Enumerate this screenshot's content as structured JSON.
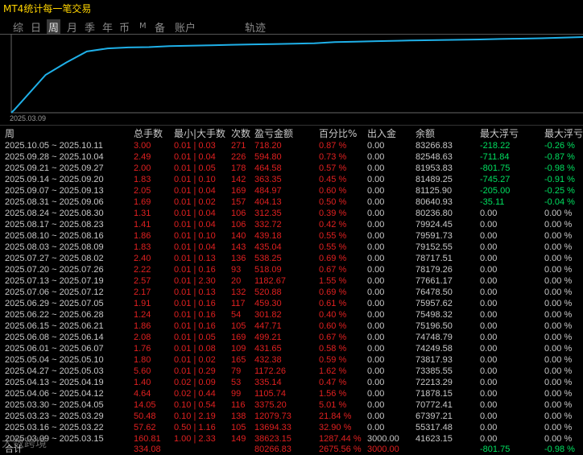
{
  "title": "MT4统计每一笔交易",
  "tabs": [
    {
      "label": "综",
      "active": false
    },
    {
      "label": "日",
      "active": false
    },
    {
      "label": "周",
      "active": true
    },
    {
      "label": "月",
      "active": false
    },
    {
      "label": "季",
      "active": false
    },
    {
      "label": "年",
      "active": false
    },
    {
      "label": "币",
      "active": false
    },
    {
      "label": "M",
      "active": false
    },
    {
      "label": "备",
      "active": false
    },
    {
      "label": "账户",
      "active": false
    },
    {
      "label": "轨迹",
      "active": false
    }
  ],
  "chart_data": {
    "type": "line",
    "x_start_label": "2025.03.09",
    "y": [
      0,
      3000,
      41623.15,
      55317.48,
      67397.21,
      70772.41,
      71878.15,
      72213.29,
      73385.55,
      73817.93,
      74249.58,
      74748.79,
      75196.5,
      75498.32,
      75957.62,
      76478.5,
      77661.17,
      78179.26,
      78717.51,
      79152.55,
      79591.73,
      79924.45,
      80236.8,
      80640.93,
      81125.9,
      81489.25,
      81953.83,
      82548.63,
      83266.83
    ],
    "line_color": "#1fb0e8"
  },
  "headers": {
    "period": "周",
    "lots": "总手数",
    "minmax": "最小|大手数",
    "count": "次数",
    "pnl": "盈亏金额",
    "pct": "百分比%",
    "flow": "出入金",
    "balance": "余额",
    "max_float": "最大浮亏",
    "max_float_pct": "最大浮亏"
  },
  "rows": [
    {
      "period": "2025.10.05 ~ 2025.10.11",
      "lots": "3.00",
      "minmax": "0.01 | 0.03",
      "count": "271",
      "pnl": "718.20",
      "pct": "0.87 %",
      "flow": "0.00",
      "balance": "83266.83",
      "mf": "-218.22",
      "mfp": "-0.26 %"
    },
    {
      "period": "2025.09.28 ~ 2025.10.04",
      "lots": "2.49",
      "minmax": "0.01 | 0.04",
      "count": "226",
      "pnl": "594.80",
      "pct": "0.73 %",
      "flow": "0.00",
      "balance": "82548.63",
      "mf": "-711.84",
      "mfp": "-0.87 %"
    },
    {
      "period": "2025.09.21 ~ 2025.09.27",
      "lots": "2.00",
      "minmax": "0.01 | 0.05",
      "count": "178",
      "pnl": "464.58",
      "pct": "0.57 %",
      "flow": "0.00",
      "balance": "81953.83",
      "mf": "-801.75",
      "mfp": "-0.98 %"
    },
    {
      "period": "2025.09.14 ~ 2025.09.20",
      "lots": "1.83",
      "minmax": "0.01 | 0.10",
      "count": "142",
      "pnl": "363.35",
      "pct": "0.45 %",
      "flow": "0.00",
      "balance": "81489.25",
      "mf": "-745.27",
      "mfp": "-0.91 %"
    },
    {
      "period": "2025.09.07 ~ 2025.09.13",
      "lots": "2.05",
      "minmax": "0.01 | 0.04",
      "count": "169",
      "pnl": "484.97",
      "pct": "0.60 %",
      "flow": "0.00",
      "balance": "81125.90",
      "mf": "-205.00",
      "mfp": "-0.25 %"
    },
    {
      "period": "2025.08.31 ~ 2025.09.06",
      "lots": "1.69",
      "minmax": "0.01 | 0.02",
      "count": "157",
      "pnl": "404.13",
      "pct": "0.50 %",
      "flow": "0.00",
      "balance": "80640.93",
      "mf": "-35.11",
      "mfp": "-0.04 %"
    },
    {
      "period": "2025.08.24 ~ 2025.08.30",
      "lots": "1.31",
      "minmax": "0.01 | 0.04",
      "count": "106",
      "pnl": "312.35",
      "pct": "0.39 %",
      "flow": "0.00",
      "balance": "80236.80",
      "mf": "0.00",
      "mfp": "0.00 %"
    },
    {
      "period": "2025.08.17 ~ 2025.08.23",
      "lots": "1.41",
      "minmax": "0.01 | 0.04",
      "count": "106",
      "pnl": "332.72",
      "pct": "0.42 %",
      "flow": "0.00",
      "balance": "79924.45",
      "mf": "0.00",
      "mfp": "0.00 %"
    },
    {
      "period": "2025.08.10 ~ 2025.08.16",
      "lots": "1.86",
      "minmax": "0.01 | 0.10",
      "count": "140",
      "pnl": "439.18",
      "pct": "0.55 %",
      "flow": "0.00",
      "balance": "79591.73",
      "mf": "0.00",
      "mfp": "0.00 %"
    },
    {
      "period": "2025.08.03 ~ 2025.08.09",
      "lots": "1.83",
      "minmax": "0.01 | 0.04",
      "count": "143",
      "pnl": "435.04",
      "pct": "0.55 %",
      "flow": "0.00",
      "balance": "79152.55",
      "mf": "0.00",
      "mfp": "0.00 %"
    },
    {
      "period": "2025.07.27 ~ 2025.08.02",
      "lots": "2.40",
      "minmax": "0.01 | 0.13",
      "count": "136",
      "pnl": "538.25",
      "pct": "0.69 %",
      "flow": "0.00",
      "balance": "78717.51",
      "mf": "0.00",
      "mfp": "0.00 %"
    },
    {
      "period": "2025.07.20 ~ 2025.07.26",
      "lots": "2.22",
      "minmax": "0.01 | 0.16",
      "count": "93",
      "pnl": "518.09",
      "pct": "0.67 %",
      "flow": "0.00",
      "balance": "78179.26",
      "mf": "0.00",
      "mfp": "0.00 %"
    },
    {
      "period": "2025.07.13 ~ 2025.07.19",
      "lots": "2.57",
      "minmax": "0.01 | 2.30",
      "count": "20",
      "pnl": "1182.67",
      "pct": "1.55 %",
      "flow": "0.00",
      "balance": "77661.17",
      "mf": "0.00",
      "mfp": "0.00 %"
    },
    {
      "period": "2025.07.06 ~ 2025.07.12",
      "lots": "2.17",
      "minmax": "0.01 | 0.13",
      "count": "132",
      "pnl": "520.88",
      "pct": "0.69 %",
      "flow": "0.00",
      "balance": "76478.50",
      "mf": "0.00",
      "mfp": "0.00 %"
    },
    {
      "period": "2025.06.29 ~ 2025.07.05",
      "lots": "1.91",
      "minmax": "0.01 | 0.16",
      "count": "117",
      "pnl": "459.30",
      "pct": "0.61 %",
      "flow": "0.00",
      "balance": "75957.62",
      "mf": "0.00",
      "mfp": "0.00 %"
    },
    {
      "period": "2025.06.22 ~ 2025.06.28",
      "lots": "1.24",
      "minmax": "0.01 | 0.16",
      "count": "54",
      "pnl": "301.82",
      "pct": "0.40 %",
      "flow": "0.00",
      "balance": "75498.32",
      "mf": "0.00",
      "mfp": "0.00 %"
    },
    {
      "period": "2025.06.15 ~ 2025.06.21",
      "lots": "1.86",
      "minmax": "0.01 | 0.16",
      "count": "105",
      "pnl": "447.71",
      "pct": "0.60 %",
      "flow": "0.00",
      "balance": "75196.50",
      "mf": "0.00",
      "mfp": "0.00 %"
    },
    {
      "period": "2025.06.08 ~ 2025.06.14",
      "lots": "2.08",
      "minmax": "0.01 | 0.05",
      "count": "169",
      "pnl": "499.21",
      "pct": "0.67 %",
      "flow": "0.00",
      "balance": "74748.79",
      "mf": "0.00",
      "mfp": "0.00 %"
    },
    {
      "period": "2025.06.01 ~ 2025.06.07",
      "lots": "1.76",
      "minmax": "0.01 | 0.08",
      "count": "109",
      "pnl": "431.65",
      "pct": "0.58 %",
      "flow": "0.00",
      "balance": "74249.58",
      "mf": "0.00",
      "mfp": "0.00 %"
    },
    {
      "period": "2025.05.04 ~ 2025.05.10",
      "lots": "1.80",
      "minmax": "0.01 | 0.02",
      "count": "165",
      "pnl": "432.38",
      "pct": "0.59 %",
      "flow": "0.00",
      "balance": "73817.93",
      "mf": "0.00",
      "mfp": "0.00 %"
    },
    {
      "period": "2025.04.27 ~ 2025.05.03",
      "lots": "5.60",
      "minmax": "0.01 | 0.29",
      "count": "79",
      "pnl": "1172.26",
      "pct": "1.62 %",
      "flow": "0.00",
      "balance": "73385.55",
      "mf": "0.00",
      "mfp": "0.00 %"
    },
    {
      "period": "2025.04.13 ~ 2025.04.19",
      "lots": "1.40",
      "minmax": "0.02 | 0.09",
      "count": "53",
      "pnl": "335.14",
      "pct": "0.47 %",
      "flow": "0.00",
      "balance": "72213.29",
      "mf": "0.00",
      "mfp": "0.00 %"
    },
    {
      "period": "2025.04.06 ~ 2025.04.12",
      "lots": "4.64",
      "minmax": "0.02 | 0.44",
      "count": "99",
      "pnl": "1105.74",
      "pct": "1.56 %",
      "flow": "0.00",
      "balance": "71878.15",
      "mf": "0.00",
      "mfp": "0.00 %"
    },
    {
      "period": "2025.03.30 ~ 2025.04.05",
      "lots": "14.05",
      "minmax": "0.10 | 0.54",
      "count": "116",
      "pnl": "3375.20",
      "pct": "5.01 %",
      "flow": "0.00",
      "balance": "70772.41",
      "mf": "0.00",
      "mfp": "0.00 %"
    },
    {
      "period": "2025.03.23 ~ 2025.03.29",
      "lots": "50.48",
      "minmax": "0.10 | 2.19",
      "count": "138",
      "pnl": "12079.73",
      "pct": "21.84 %",
      "flow": "0.00",
      "balance": "67397.21",
      "mf": "0.00",
      "mfp": "0.00 %"
    },
    {
      "period": "2025.03.16 ~ 2025.03.22",
      "lots": "57.62",
      "minmax": "0.50 | 1.16",
      "count": "105",
      "pnl": "13694.33",
      "pct": "32.90 %",
      "flow": "0.00",
      "balance": "55317.48",
      "mf": "0.00",
      "mfp": "0.00 %"
    },
    {
      "period": "2025.03.09 ~ 2025.03.15",
      "lots": "160.81",
      "minmax": "1.00 | 2.33",
      "count": "149",
      "pnl": "38623.15",
      "pct": "1287.44 %",
      "flow": "3000.00",
      "balance": "41623.15",
      "mf": "0.00",
      "mfp": "0.00 %"
    }
  ],
  "totals": {
    "label": "合计",
    "lots": "334.08",
    "pnl": "80266.83",
    "pct": "2675.56 %",
    "flow": "3000.00",
    "mf": "-801.75",
    "mfp": "-0.98 %"
  },
  "watermark": "大数跨境",
  "colors": {
    "positive": "#e02020",
    "negative": "#00e060",
    "neutral": "#c8c8c8",
    "accent": "#ffd400",
    "line": "#1fb0e8"
  }
}
